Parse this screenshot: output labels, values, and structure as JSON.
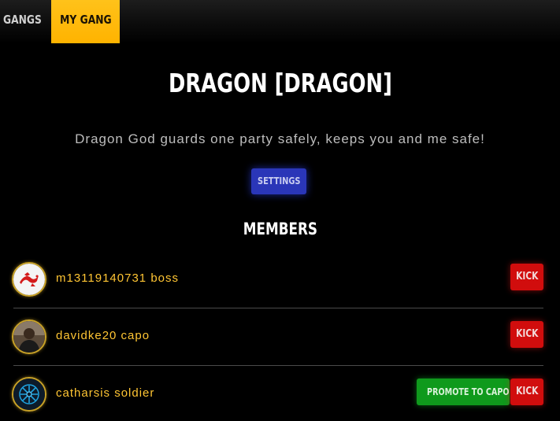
{
  "tabs": [
    {
      "label": "GANGS",
      "active": false
    },
    {
      "label": "MY GANG",
      "active": true
    }
  ],
  "gang": {
    "title": "DRAGON [DRAGON]",
    "description": "Dragon God guards one party safely, keeps you and me safe!",
    "settings_label": "SETTINGS"
  },
  "members_heading": "MEMBERS",
  "members": [
    {
      "name": "m13119140731 boss",
      "avatar_icon": "dragon-emblem-icon",
      "kick_label": "KICK"
    },
    {
      "name": "davidke20 capo",
      "avatar_icon": "user-photo-icon",
      "kick_label": "KICK"
    },
    {
      "name": "catharsis soldier",
      "avatar_icon": "blue-sigil-icon",
      "kick_label": "KICK",
      "promote_label": "PROMOTE TO CAPO"
    }
  ],
  "colors": {
    "accent_tab": "#ffb300",
    "settings_button": "#2a36b8",
    "kick_button": "#d10d0d",
    "promote_button": "#0f9a1c",
    "member_name": "#ffc533"
  }
}
